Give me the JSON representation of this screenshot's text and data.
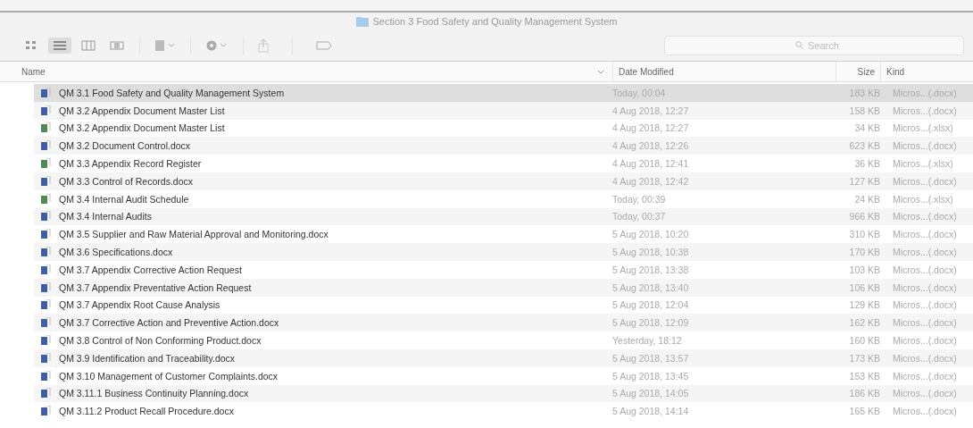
{
  "window": {
    "title": "Section 3 Food Safety and Quality Management System"
  },
  "toolbar": {
    "view_buttons": [
      {
        "kind": "icons",
        "selected": false
      },
      {
        "kind": "list",
        "selected": true
      },
      {
        "kind": "columns",
        "selected": false
      },
      {
        "kind": "coverflow",
        "selected": false
      }
    ]
  },
  "search": {
    "placeholder": "Search"
  },
  "table": {
    "columns": [
      {
        "label": "Name"
      },
      {
        "label": "Date Modified"
      },
      {
        "label": "Size"
      },
      {
        "label": "Kind"
      }
    ],
    "rows": [
      {
        "kind": "word",
        "name": "QM 3.1 Food Safety and Quality Management System",
        "date": "Today, 00:04",
        "size": "183 KB",
        "type": "Micros...(.docx)",
        "selected": true
      },
      {
        "kind": "word",
        "name": "QM 3.2 Appendix Document Master List",
        "date": "4 Aug 2018, 12:27",
        "size": "158 KB",
        "type": "Micros...(.docx)",
        "selected": false
      },
      {
        "kind": "excel",
        "name": "QM 3.2 Appendix Document Master List",
        "date": "4 Aug 2018, 12:27",
        "size": "34 KB",
        "type": "Micros...(.xlsx)",
        "selected": false
      },
      {
        "kind": "word",
        "name": "QM 3.2 Document Control.docx",
        "date": "4 Aug 2018, 12:26",
        "size": "623 KB",
        "type": "Micros...(.docx)",
        "selected": false
      },
      {
        "kind": "excel",
        "name": "QM 3.3 Appendix Record Register",
        "date": "4 Aug 2018, 12:41",
        "size": "36 KB",
        "type": "Micros...(.xlsx)",
        "selected": false
      },
      {
        "kind": "word",
        "name": "QM 3.3 Control of Records.docx",
        "date": "4 Aug 2018, 12:42",
        "size": "127 KB",
        "type": "Micros...(.docx)",
        "selected": false
      },
      {
        "kind": "excel",
        "name": "QM 3.4 Internal Audit Schedule",
        "date": "Today, 00:39",
        "size": "24 KB",
        "type": "Micros...(.xlsx)",
        "selected": false
      },
      {
        "kind": "word",
        "name": "QM 3.4 Internal Audits",
        "date": "Today, 00:37",
        "size": "966 KB",
        "type": "Micros...(.docx)",
        "selected": false
      },
      {
        "kind": "word",
        "name": "QM 3.5 Supplier and Raw Material Approval and Monitoring.docx",
        "date": "5 Aug 2018, 10:20",
        "size": "310 KB",
        "type": "Micros...(.docx)",
        "selected": false
      },
      {
        "kind": "word",
        "name": "QM 3.6 Specifications.docx",
        "date": "5 Aug 2018, 10:38",
        "size": "170 KB",
        "type": "Micros...(.docx)",
        "selected": false
      },
      {
        "kind": "word",
        "name": "QM 3.7 Appendix Corrective Action Request",
        "date": "5 Aug 2018, 13:38",
        "size": "103 KB",
        "type": "Micros...(.docx)",
        "selected": false
      },
      {
        "kind": "word",
        "name": "QM 3.7 Appendix Preventative Action Request",
        "date": "5 Aug 2018, 13:40",
        "size": "106 KB",
        "type": "Micros...(.docx)",
        "selected": false
      },
      {
        "kind": "word",
        "name": "QM 3.7 Appendix Root Cause Analysis",
        "date": "5 Aug 2018, 12:04",
        "size": "129 KB",
        "type": "Micros...(.docx)",
        "selected": false
      },
      {
        "kind": "word",
        "name": "QM 3.7 Corrective Action and Preventive Action.docx",
        "date": "5 Aug 2018, 12:09",
        "size": "162 KB",
        "type": "Micros...(.docx)",
        "selected": false
      },
      {
        "kind": "word",
        "name": "QM 3.8 Control of Non Conforming Product.docx",
        "date": "Yesterday, 18:12",
        "size": "160 KB",
        "type": "Micros...(.docx)",
        "selected": false
      },
      {
        "kind": "word",
        "name": "QM 3.9 Identification and Traceability.docx",
        "date": "5 Aug 2018, 13:57",
        "size": "173 KB",
        "type": "Micros...(.docx)",
        "selected": false
      },
      {
        "kind": "word",
        "name": "QM 3.10 Management of Customer Complaints.docx",
        "date": "5 Aug 2018, 13:45",
        "size": "153 KB",
        "type": "Micros...(.docx)",
        "selected": false
      },
      {
        "kind": "word",
        "name": "QM 3.11.1 Business Continuity Planning.docx",
        "date": "5 Aug 2018, 14:05",
        "size": "186 KB",
        "type": "Micros...(.docx)",
        "selected": false
      },
      {
        "kind": "word",
        "name": "QM 3.11.2 Product Recall Procedure.docx",
        "date": "5 Aug 2018, 14:14",
        "size": "165 KB",
        "type": "Micros...(.docx)",
        "selected": false
      }
    ]
  }
}
